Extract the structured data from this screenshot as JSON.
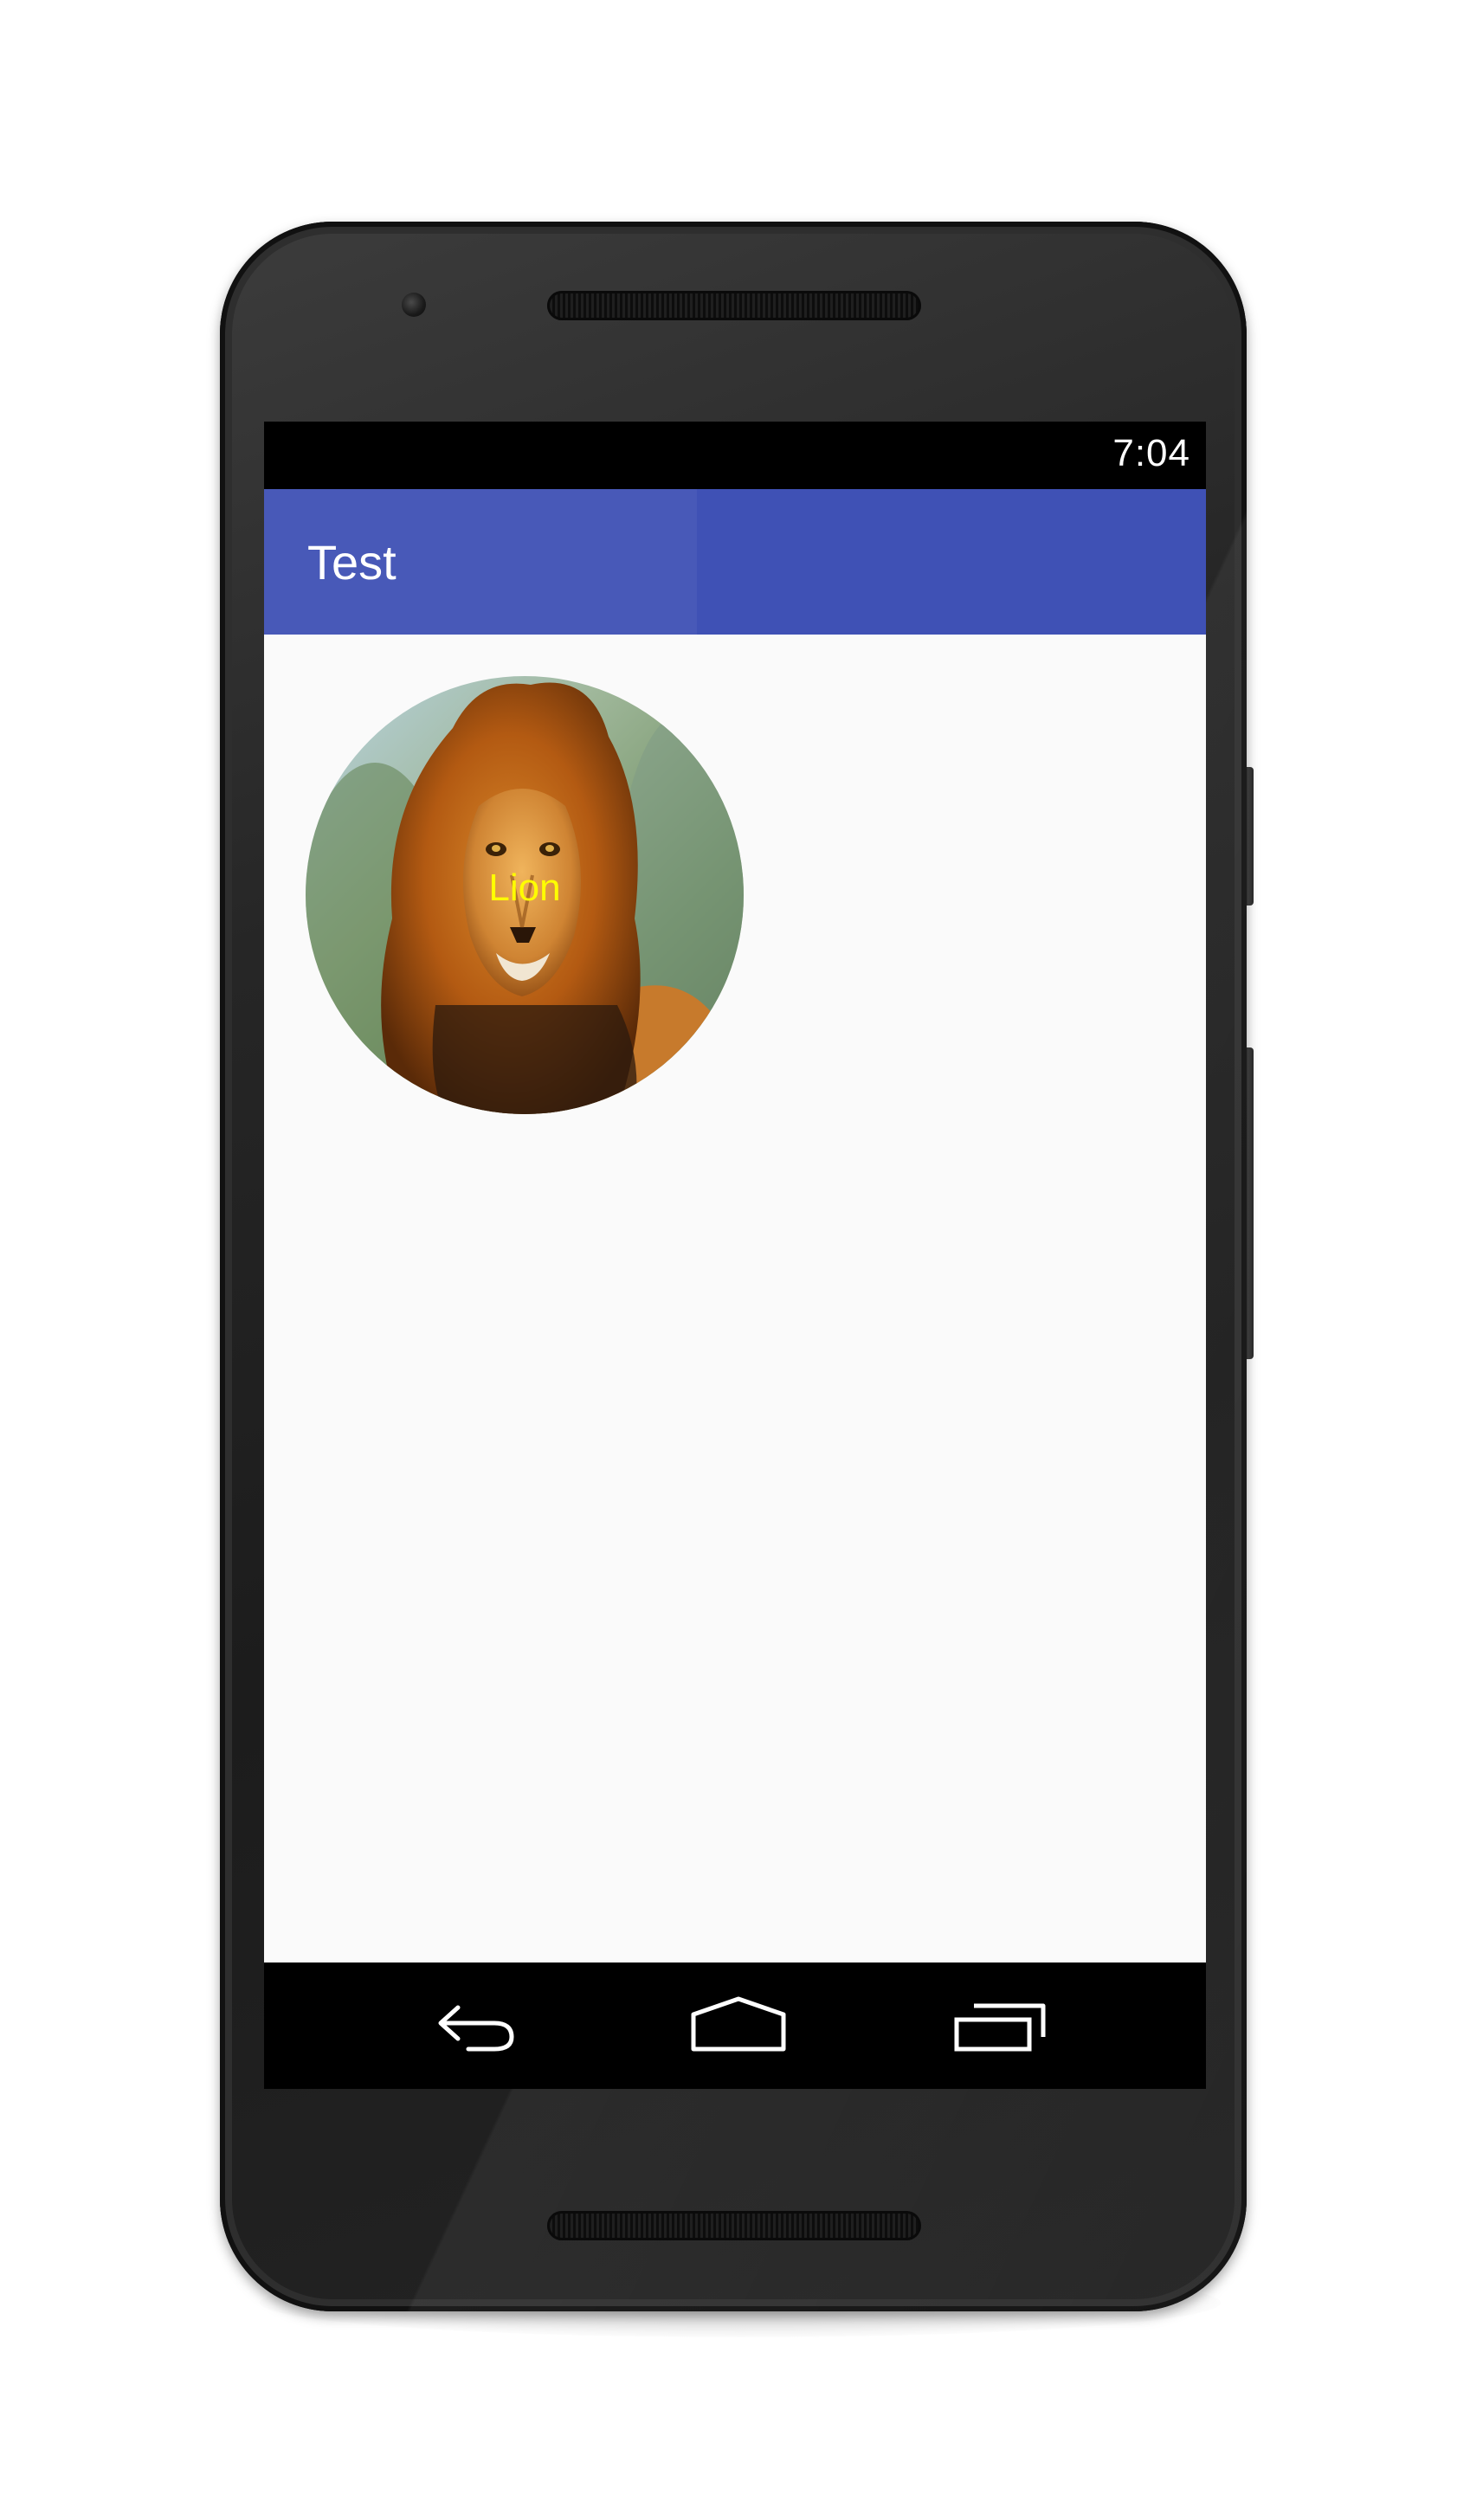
{
  "status_bar": {
    "time": "7:04"
  },
  "app_bar": {
    "title": "Test",
    "color": "#3f51b5"
  },
  "content": {
    "avatar": {
      "label": "Lion",
      "label_color": "#ffff00",
      "image": "lion-photo"
    }
  },
  "nav_bar": {
    "buttons": [
      {
        "name": "back",
        "icon": "back-arrow-icon"
      },
      {
        "name": "home",
        "icon": "home-icon"
      },
      {
        "name": "recents",
        "icon": "recent-apps-icon"
      }
    ]
  }
}
